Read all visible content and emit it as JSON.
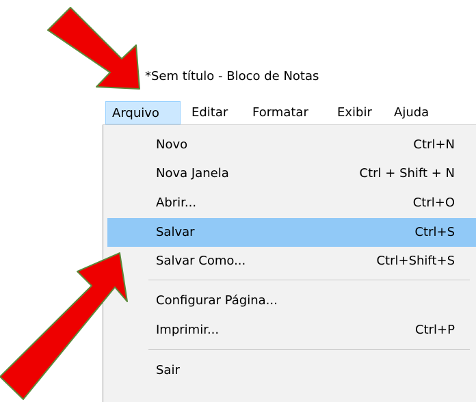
{
  "window": {
    "title": "*Sem título - Bloco de Notas"
  },
  "menubar": {
    "items": [
      {
        "label": "Arquivo",
        "active": true
      },
      {
        "label": "Editar",
        "active": false
      },
      {
        "label": "Formatar",
        "active": false
      },
      {
        "label": "Exibir",
        "active": false
      },
      {
        "label": "Ajuda",
        "active": false
      }
    ]
  },
  "file_menu": {
    "items": [
      {
        "label": "Novo",
        "shortcut": "Ctrl+N"
      },
      {
        "label": "Nova Janela",
        "shortcut": "Ctrl + Shift + N"
      },
      {
        "label": "Abrir...",
        "shortcut": "Ctrl+O"
      },
      {
        "label": "Salvar",
        "shortcut": "Ctrl+S",
        "highlighted": true
      },
      {
        "label": "Salvar Como...",
        "shortcut": "Ctrl+Shift+S"
      },
      {
        "label": "Configurar Página...",
        "shortcut": ""
      },
      {
        "label": "Imprimir...",
        "shortcut": "Ctrl+P"
      },
      {
        "label": "Sair",
        "shortcut": ""
      }
    ]
  },
  "annotations": {
    "arrow_color": "#ee0000",
    "arrow_outline": "#5a8a3a"
  },
  "colors": {
    "menu_background": "#f2f2f2",
    "highlight": "#91c9f7",
    "active_menu": "#cce8ff"
  }
}
